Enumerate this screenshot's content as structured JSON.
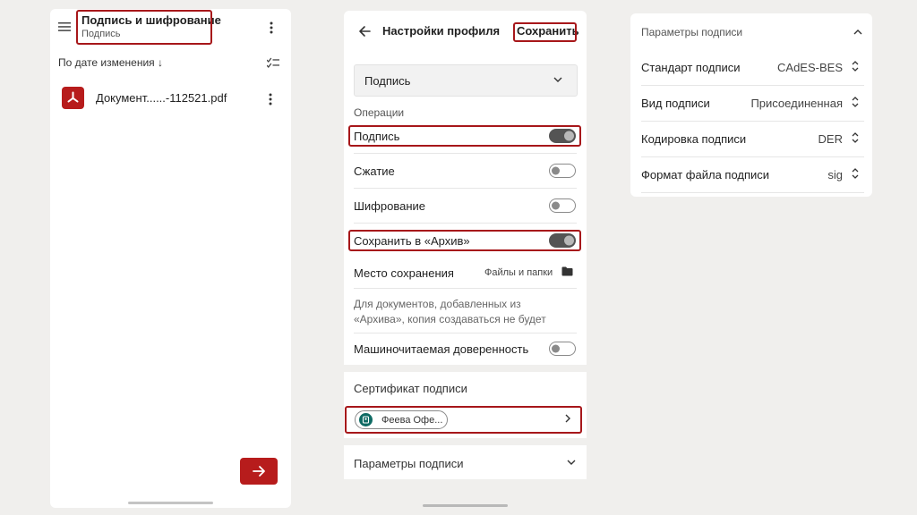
{
  "colors": {
    "accent": "#b71c1c",
    "highlight": "#a7171a",
    "background": "#f0efed"
  },
  "left": {
    "title": "Подпись и шифрование",
    "subtitle": "Подпись",
    "sort_label": "По дате изменения",
    "sort_arrow": "↓",
    "file_name": "Документ......-112521.pdf",
    "icons": {
      "menu": "hamburger-icon",
      "more": "more-vert-icon",
      "select": "checklist-icon",
      "file": "pdf-icon",
      "next": "arrow-right-icon"
    }
  },
  "middle": {
    "title": "Настройки профиля",
    "save_label": "Сохранить",
    "profile_select": "Подпись",
    "section_operations": "Операции",
    "toggles": [
      {
        "label": "Подпись",
        "on": true
      },
      {
        "label": "Сжатие",
        "on": false
      },
      {
        "label": "Шифрование",
        "on": false
      },
      {
        "label": "Сохранить в «Архив»",
        "on": true
      }
    ],
    "save_location_label": "Место сохранения",
    "save_location_value": "Файлы и папки",
    "archive_note_line1": "Для документов, добавленных из",
    "archive_note_line2": "«Архива», копия создаваться не будет",
    "machine_readable_label": "Машиночитаемая доверенность",
    "machine_readable_on": false,
    "certificate_title": "Сертификат подписи",
    "certificate_chip": "Феева Офе...",
    "params_title": "Параметры подписи"
  },
  "right": {
    "title": "Параметры подписи",
    "rows": [
      {
        "label": "Стандарт подписи",
        "value": "CAdES-BES"
      },
      {
        "label": "Вид подписи",
        "value": "Присоединенная"
      },
      {
        "label": "Кодировка подписи",
        "value": "DER"
      },
      {
        "label": "Формат файла подписи",
        "value": "sig"
      }
    ]
  }
}
